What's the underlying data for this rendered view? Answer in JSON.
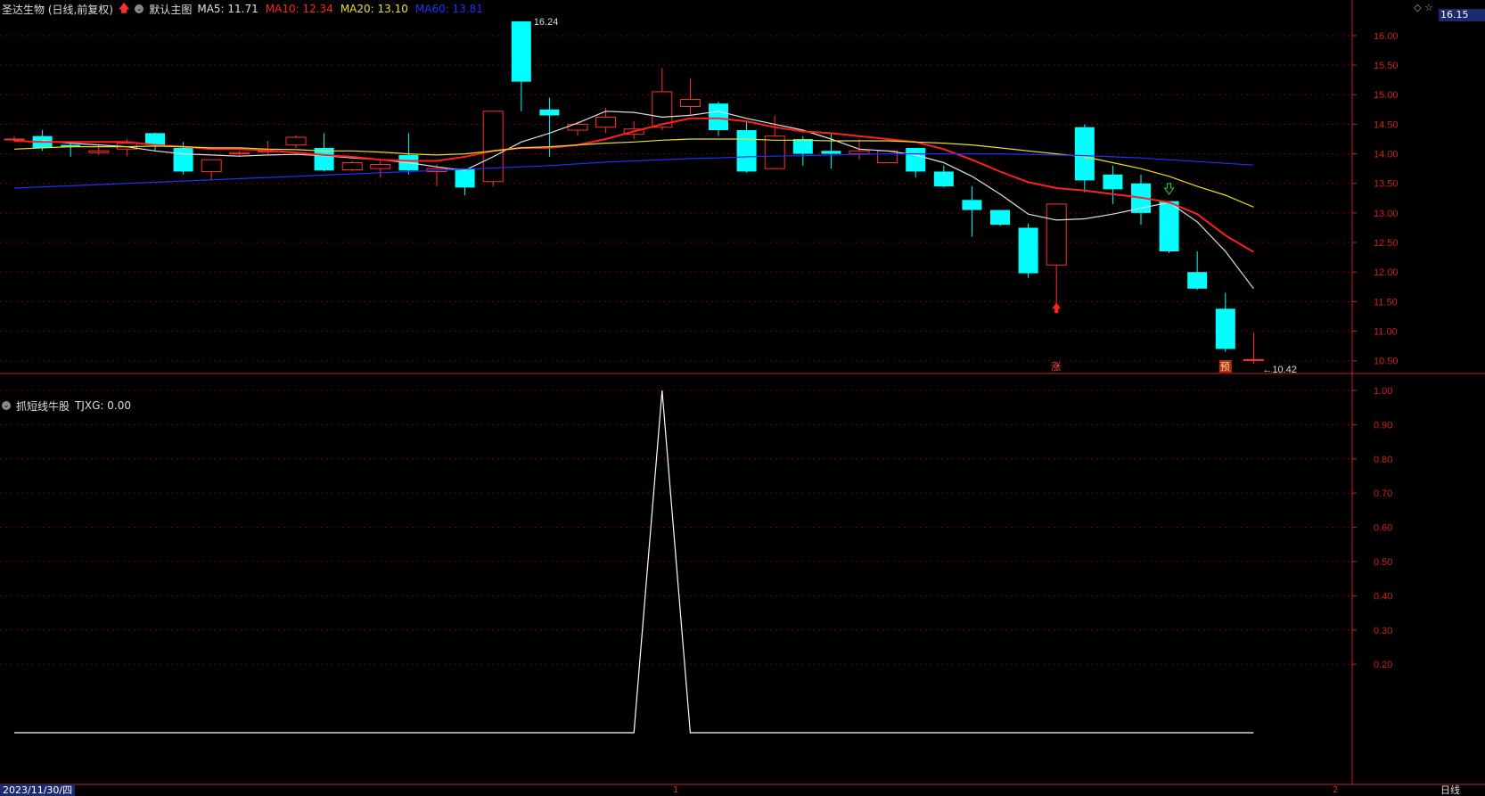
{
  "header": {
    "stock_name": "圣达生物 (日线,前复权)",
    "main_chart_label": "默认主图",
    "ma_items": [
      {
        "label": "MA5: 11.71",
        "color": "#e0e0e0"
      },
      {
        "label": "MA10: 12.34",
        "color": "#ff2020"
      },
      {
        "label": "MA20: 13.10",
        "color": "#e8e020"
      },
      {
        "label": "MA60: 13.81",
        "color": "#2030ff"
      }
    ]
  },
  "sub_header": {
    "indicator_name": "抓短线牛股",
    "value_label": "TJXG: 0.00"
  },
  "right_panel": {
    "current_price": "16.15",
    "period": "日线",
    "corner_icons": "◇ ☆"
  },
  "bottom": {
    "date": "2023/11/30/四",
    "tag_1": "1",
    "tag_2": "2"
  },
  "colors": {
    "up": "#ff3030",
    "down": "#00ffff",
    "grid": "#7a0000",
    "axis": "#cc2020"
  },
  "chart_data": [
    {
      "type": "candlestick",
      "title": "",
      "ylim": [
        10.3,
        16.3
      ],
      "y_ticks": [
        "10.50",
        "11.00",
        "11.50",
        "12.00",
        "12.50",
        "13.00",
        "13.50",
        "14.00",
        "14.50",
        "15.00",
        "15.50",
        "16.00"
      ],
      "annotations": {
        "high_label": "16.24",
        "low_label": "10.42",
        "up_tag": "涨",
        "last_tag": "预"
      },
      "candles": [
        {
          "o": 14.25,
          "h": 14.3,
          "l": 14.2,
          "c": 14.25,
          "up": true
        },
        {
          "o": 14.3,
          "h": 14.4,
          "l": 14.05,
          "c": 14.1,
          "up": false
        },
        {
          "o": 14.15,
          "h": 14.17,
          "l": 13.95,
          "c": 14.12,
          "up": false
        },
        {
          "o": 14.02,
          "h": 14.15,
          "l": 13.98,
          "c": 14.05,
          "up": true
        },
        {
          "o": 14.08,
          "h": 14.25,
          "l": 13.97,
          "c": 14.18,
          "up": true
        },
        {
          "o": 14.35,
          "h": 14.36,
          "l": 14.05,
          "c": 14.15,
          "up": false
        },
        {
          "o": 14.1,
          "h": 14.2,
          "l": 13.65,
          "c": 13.7,
          "up": false
        },
        {
          "o": 13.7,
          "h": 13.9,
          "l": 13.55,
          "c": 13.9,
          "up": true
        },
        {
          "o": 14.0,
          "h": 14.05,
          "l": 13.95,
          "c": 14.02,
          "up": true
        },
        {
          "o": 14.05,
          "h": 14.22,
          "l": 14.0,
          "c": 14.05,
          "up": true
        },
        {
          "o": 14.15,
          "h": 14.31,
          "l": 14.1,
          "c": 14.28,
          "up": true
        },
        {
          "o": 14.1,
          "h": 14.35,
          "l": 13.7,
          "c": 13.72,
          "up": false
        },
        {
          "o": 13.73,
          "h": 13.88,
          "l": 13.7,
          "c": 13.85,
          "up": true
        },
        {
          "o": 13.75,
          "h": 13.88,
          "l": 13.6,
          "c": 13.82,
          "up": true
        },
        {
          "o": 13.98,
          "h": 14.35,
          "l": 13.65,
          "c": 13.72,
          "up": false
        },
        {
          "o": 13.75,
          "h": 13.82,
          "l": 13.45,
          "c": 13.7,
          "up": true
        },
        {
          "o": 13.75,
          "h": 13.75,
          "l": 13.3,
          "c": 13.43,
          "up": false
        },
        {
          "o": 13.53,
          "h": 14.72,
          "l": 13.45,
          "c": 14.72,
          "up": true
        },
        {
          "o": 15.22,
          "h": 16.24,
          "l": 14.72,
          "c": 16.24,
          "up": false
        },
        {
          "o": 14.75,
          "h": 14.95,
          "l": 13.95,
          "c": 14.65,
          "up": false
        },
        {
          "o": 14.4,
          "h": 14.55,
          "l": 14.3,
          "c": 14.5,
          "up": true
        },
        {
          "o": 14.45,
          "h": 14.78,
          "l": 14.35,
          "c": 14.62,
          "up": true
        },
        {
          "o": 14.33,
          "h": 14.55,
          "l": 14.25,
          "c": 14.42,
          "up": true
        },
        {
          "o": 14.45,
          "h": 15.45,
          "l": 14.4,
          "c": 15.05,
          "up": true
        },
        {
          "o": 14.8,
          "h": 15.28,
          "l": 14.65,
          "c": 14.92,
          "up": true
        },
        {
          "o": 14.85,
          "h": 14.88,
          "l": 14.3,
          "c": 14.4,
          "up": false
        },
        {
          "o": 14.4,
          "h": 14.55,
          "l": 13.68,
          "c": 13.7,
          "up": false
        },
        {
          "o": 13.75,
          "h": 14.65,
          "l": 13.75,
          "c": 14.3,
          "up": true
        },
        {
          "o": 14.25,
          "h": 14.3,
          "l": 13.8,
          "c": 14.0,
          "up": false
        },
        {
          "o": 14.0,
          "h": 14.35,
          "l": 13.75,
          "c": 14.05,
          "up": false
        },
        {
          "o": 14.0,
          "h": 14.25,
          "l": 13.9,
          "c": 14.05,
          "up": true
        },
        {
          "o": 13.85,
          "h": 14.05,
          "l": 13.85,
          "c": 14.05,
          "up": true
        },
        {
          "o": 14.1,
          "h": 14.1,
          "l": 13.6,
          "c": 13.7,
          "up": false
        },
        {
          "o": 13.7,
          "h": 13.8,
          "l": 13.43,
          "c": 13.45,
          "up": false
        },
        {
          "o": 13.22,
          "h": 13.45,
          "l": 12.6,
          "c": 13.05,
          "up": false
        },
        {
          "o": 13.05,
          "h": 13.05,
          "l": 12.78,
          "c": 12.8,
          "up": false
        },
        {
          "o": 12.75,
          "h": 12.82,
          "l": 11.9,
          "c": 11.98,
          "up": false
        },
        {
          "o": 12.12,
          "h": 13.15,
          "l": 11.45,
          "c": 13.15,
          "up": true
        },
        {
          "o": 14.45,
          "h": 14.5,
          "l": 13.35,
          "c": 13.55,
          "up": false
        },
        {
          "o": 13.65,
          "h": 13.8,
          "l": 13.15,
          "c": 13.4,
          "up": false
        },
        {
          "o": 13.5,
          "h": 13.65,
          "l": 12.8,
          "c": 13.0,
          "up": false
        },
        {
          "o": 13.2,
          "h": 13.2,
          "l": 12.32,
          "c": 12.35,
          "up": false
        },
        {
          "o": 12.0,
          "h": 12.35,
          "l": 11.7,
          "c": 11.72,
          "up": false
        },
        {
          "o": 11.38,
          "h": 11.65,
          "l": 10.65,
          "c": 10.7,
          "up": false
        },
        {
          "o": 10.52,
          "h": 10.98,
          "l": 10.45,
          "c": 10.52,
          "up": true
        }
      ],
      "series": [
        {
          "name": "MA5",
          "color": "#e0e0e0",
          "start": 1,
          "values": [
            14.22,
            14.18,
            14.15,
            14.12,
            14.05,
            14.0,
            13.98,
            13.96,
            13.98,
            13.99,
            13.97,
            13.93,
            13.9,
            13.85,
            13.78,
            13.72,
            13.95,
            14.2,
            14.35,
            14.52,
            14.72,
            14.7,
            14.62,
            14.65,
            14.72,
            14.6,
            14.5,
            14.4,
            14.25,
            14.08,
            14.05,
            13.98,
            13.85,
            13.62,
            13.32,
            12.98,
            12.88,
            12.9,
            12.98,
            13.08,
            13.18,
            12.85,
            12.35,
            11.72
          ]
        },
        {
          "name": "MA10",
          "color": "#ff2020",
          "start": 0,
          "values": [
            14.22,
            14.2,
            14.2,
            14.2,
            14.2,
            14.15,
            14.12,
            14.08,
            14.08,
            14.06,
            14.02,
            13.98,
            13.95,
            13.9,
            13.88,
            13.88,
            13.95,
            14.05,
            14.1,
            14.1,
            14.15,
            14.25,
            14.38,
            14.5,
            14.6,
            14.6,
            14.55,
            14.45,
            14.38,
            14.35,
            14.3,
            14.25,
            14.2,
            14.08,
            13.9,
            13.7,
            13.52,
            13.42,
            13.38,
            13.32,
            13.26,
            13.18,
            12.98,
            12.62,
            12.34
          ]
        },
        {
          "name": "MA20",
          "color": "#e8e020",
          "start": 0,
          "values": [
            14.08,
            14.1,
            14.12,
            14.12,
            14.12,
            14.13,
            14.12,
            14.1,
            14.1,
            14.08,
            14.07,
            14.05,
            14.05,
            14.03,
            14.0,
            13.98,
            14.0,
            14.05,
            14.1,
            14.12,
            14.15,
            14.18,
            14.2,
            14.23,
            14.25,
            14.25,
            14.25,
            14.23,
            14.23,
            14.22,
            14.22,
            14.22,
            14.2,
            14.18,
            14.15,
            14.1,
            14.05,
            14.0,
            13.95,
            13.85,
            13.75,
            13.62,
            13.45,
            13.3,
            13.1
          ]
        },
        {
          "name": "MA60",
          "color": "#2030ff",
          "start": 0,
          "values": [
            13.42,
            13.44,
            13.46,
            13.48,
            13.5,
            13.52,
            13.54,
            13.56,
            13.58,
            13.6,
            13.62,
            13.64,
            13.66,
            13.68,
            13.7,
            13.72,
            13.74,
            13.76,
            13.78,
            13.8,
            13.83,
            13.86,
            13.88,
            13.9,
            13.92,
            13.93,
            13.95,
            13.96,
            13.97,
            13.98,
            13.99,
            14.0,
            14.0,
            14.0,
            14.0,
            14.0,
            13.99,
            13.98,
            13.97,
            13.95,
            13.93,
            13.9,
            13.87,
            13.84,
            13.81
          ]
        }
      ]
    },
    {
      "type": "line",
      "title": "",
      "ylim": [
        0,
        1.0
      ],
      "y_ticks": [
        "0.20",
        "0.30",
        "0.40",
        "0.50",
        "0.60",
        "0.70",
        "0.80",
        "0.90",
        "1.00"
      ],
      "series": [
        {
          "name": "TJXG",
          "color": "#ffffff",
          "values": [
            0,
            0,
            0,
            0,
            0,
            0,
            0,
            0,
            0,
            0,
            0,
            0,
            0,
            0,
            0,
            0,
            0,
            0,
            0,
            0,
            0,
            0,
            0,
            1,
            0,
            0,
            0,
            0,
            0,
            0,
            0,
            0,
            0,
            0,
            0,
            0,
            0,
            0,
            0,
            0,
            0,
            0,
            0,
            0,
            0
          ]
        }
      ]
    }
  ]
}
